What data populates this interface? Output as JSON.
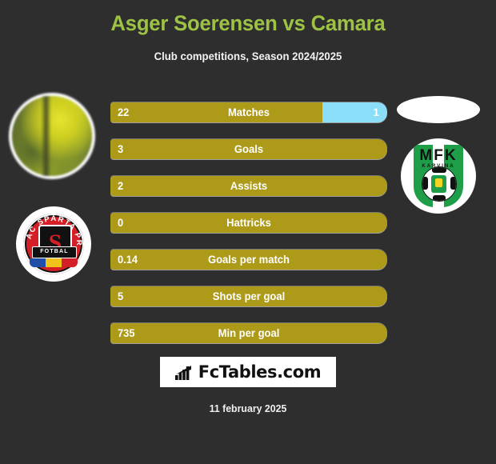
{
  "header": {
    "title": "Asger Soerensen vs Camara",
    "subtitle": "Club competitions, Season 2024/2025",
    "title_color": "#9dc244"
  },
  "colors": {
    "background": "#2e2e2e",
    "home_bar": "#ad9a19",
    "away_bar": "#8adef8",
    "title_green": "#9dc244"
  },
  "home": {
    "club": "AC SPARTA PRAHA",
    "club_sub": "FOTBAL",
    "crest_letter": "S"
  },
  "away": {
    "club": "MFK",
    "club_sub": "KARVINA"
  },
  "stats": [
    {
      "label": "Matches",
      "home": "22",
      "away": "1",
      "home_pct": 76.5,
      "away_pct": 23.5,
      "split": true
    },
    {
      "label": "Goals",
      "home": "3",
      "away": "",
      "home_pct": 100,
      "away_pct": 0,
      "split": false
    },
    {
      "label": "Assists",
      "home": "2",
      "away": "",
      "home_pct": 100,
      "away_pct": 0,
      "split": false
    },
    {
      "label": "Hattricks",
      "home": "0",
      "away": "",
      "home_pct": 100,
      "away_pct": 0,
      "split": false
    },
    {
      "label": "Goals per match",
      "home": "0.14",
      "away": "",
      "home_pct": 100,
      "away_pct": 0,
      "split": false
    },
    {
      "label": "Shots per goal",
      "home": "5",
      "away": "",
      "home_pct": 100,
      "away_pct": 0,
      "split": false
    },
    {
      "label": "Min per goal",
      "home": "735",
      "away": "",
      "home_pct": 100,
      "away_pct": 0,
      "split": false
    }
  ],
  "footer": {
    "brand": "FcTables.com",
    "brand_icon": "bar-chart-icon",
    "date": "11 february 2025"
  }
}
